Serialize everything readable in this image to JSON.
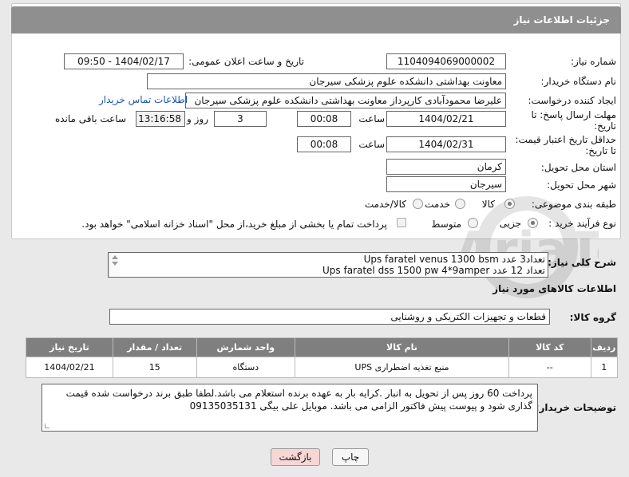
{
  "header": {
    "title": "جزئیات اطلاعات نیاز"
  },
  "fields": {
    "need_number_label": "شماره نیاز:",
    "need_number": "1104094069000002",
    "announce_label": "تاریخ و ساعت اعلان عمومی:",
    "announce_value": "1404/02/17 - 09:50",
    "buyer_org_label": "نام دستگاه خریدار:",
    "buyer_org": "معاونت بهداشتی دانشکده علوم پزشکی سیرجان",
    "creator_label": "ایجاد کننده درخواست:",
    "creator": "علیرضا  محمودآبادی کارپرداز معاونت بهداشتی دانشکده علوم پزشکی سیرجان",
    "buyer_contact_link": "اطلاعات تماس خریدار",
    "reply_deadline_label_1": "مهلت ارسال پاسخ: تا",
    "reply_deadline_label_2": "تاریخ:",
    "reply_date": "1404/02/21",
    "time_label": "ساعت",
    "reply_time": "00:08",
    "days_value": "3",
    "days_label": "روز و",
    "remaining_time": "13:16:58",
    "remaining_label": "ساعت باقی مانده",
    "price_validity_label_1": "حداقل تاریخ اعتبار قیمت:",
    "price_validity_label_2": "تا تاریخ:",
    "validity_date": "1404/02/31",
    "validity_time_label": "ساعت",
    "validity_time": "00:08",
    "province_label": "استان محل تحویل:",
    "province": "کرمان",
    "city_label": "شهر محل تحویل:",
    "city": "سیرجان",
    "category_label": "طبقه بندی موضوعی:",
    "category_options": [
      "کالا",
      "خدمت",
      "کالا/خدمت"
    ],
    "process_label": "نوع فرآیند خرید :",
    "process_options": [
      "جزیی",
      "متوسط"
    ],
    "payment_note": "پرداخت تمام یا بخشی از مبلغ خرید،از محل \"اسناد خزانه اسلامی\" خواهد بود."
  },
  "description": {
    "label": "شرح کلی نیاز:",
    "line1": "Ups faratel venus 1300 bsm تعداد3 عدد",
    "line2": "Ups faratel dss 1500 pw 4*9amper تعداد 12 عدد"
  },
  "goods_section_title": "اطلاعات کالاهای مورد نیاز",
  "goods_group": {
    "label": "گروه کالا:",
    "value": "قطعات و تجهیزات الکتریکی و روشنایی"
  },
  "table": {
    "headers": [
      "ردیف",
      "کد کالا",
      "نام کالا",
      "واحد شمارش",
      "تعداد / مقدار",
      "تاریخ نیاز"
    ],
    "rows": [
      [
        "1",
        "--",
        "منبع تغذیه اضطراری UPS",
        "دستگاه",
        "15",
        "1404/02/21"
      ]
    ]
  },
  "buyer_notes": {
    "label": "توضیحات خریدار:",
    "text": "پرداخت 60 روز پس از تحویل به انبار .کرایه بار به عهده برنده استعلام می باشد.لطفا طبق برند درخواست شده قیمت گذاری شود و پیوست پیش فاکتور الزامی می باشد. موبایل علی بیگی 09135035131"
  },
  "buttons": {
    "print": "چاپ",
    "back": "بازگشت"
  },
  "watermark": {
    "text": "AriaTender.neT"
  }
}
